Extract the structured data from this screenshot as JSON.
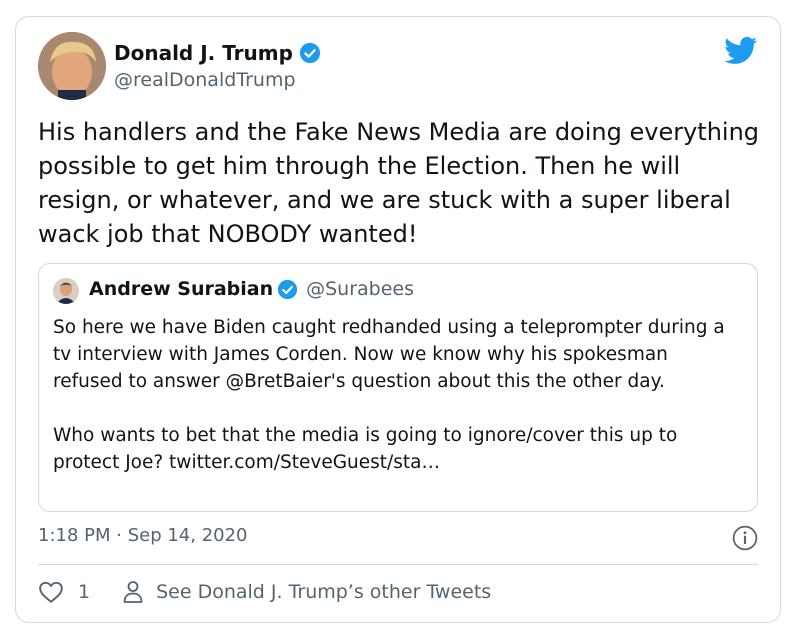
{
  "author": {
    "name": "Donald J. Trump",
    "handle": "@realDonaldTrump",
    "verified_icon": "verified-badge-icon"
  },
  "brand_icon": "twitter-bird-icon",
  "colors": {
    "accent": "#1d9bf0",
    "secondary_text": "#536471",
    "border": "#cfd9de"
  },
  "tweet": {
    "text": "His handlers and the Fake News Media are doing everything possible to get him through the Election. Then he will resign, or whatever, and we are stuck with a super liberal wack job that NOBODY wanted!"
  },
  "quoted_tweet": {
    "name": "Andrew Surabian",
    "handle": "@Surabees",
    "paragraphs": [
      "So here we have Biden caught redhanded using a teleprompter during a tv interview with James Corden. Now we know why his spokesman refused to answer @BretBaier's question about this the other day.",
      "Who wants to bet that the media is going to ignore/cover this up to protect Joe? twitter.com/SteveGuest/sta…"
    ]
  },
  "timestamp": "1:18 PM · Sep 14, 2020",
  "footer": {
    "like_count": "1",
    "other_tweets_label": "See Donald J. Trump’s other Tweets"
  }
}
